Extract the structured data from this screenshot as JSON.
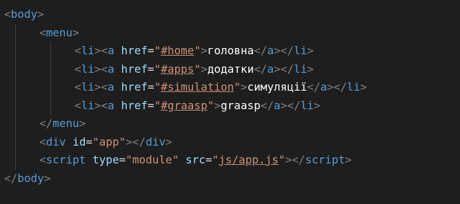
{
  "code": {
    "body_open": "body",
    "menu_open": "menu",
    "menu_items": [
      {
        "tag": "li",
        "a": "a",
        "attr": "href",
        "href": "#home",
        "text": "головна"
      },
      {
        "tag": "li",
        "a": "a",
        "attr": "href",
        "href": "#apps",
        "text": "додатки"
      },
      {
        "tag": "li",
        "a": "a",
        "attr": "href",
        "href": "#simulation",
        "text": "симуляції"
      },
      {
        "tag": "li",
        "a": "a",
        "attr": "href",
        "href": "#graasp",
        "text": "graasp"
      }
    ],
    "menu_close": "menu",
    "div": {
      "tag": "div",
      "attr": "id",
      "value": "app"
    },
    "script": {
      "tag": "script",
      "attr1": "type",
      "value1": "module",
      "attr2": "src",
      "value2": "js/app.js"
    },
    "body_close": "body"
  },
  "colors": {
    "background": "#1e1e1e",
    "tag": "#569cd6",
    "attribute": "#9cdcfe",
    "string": "#ce9178",
    "punctuation": "#808080",
    "text": "#ffffff"
  }
}
